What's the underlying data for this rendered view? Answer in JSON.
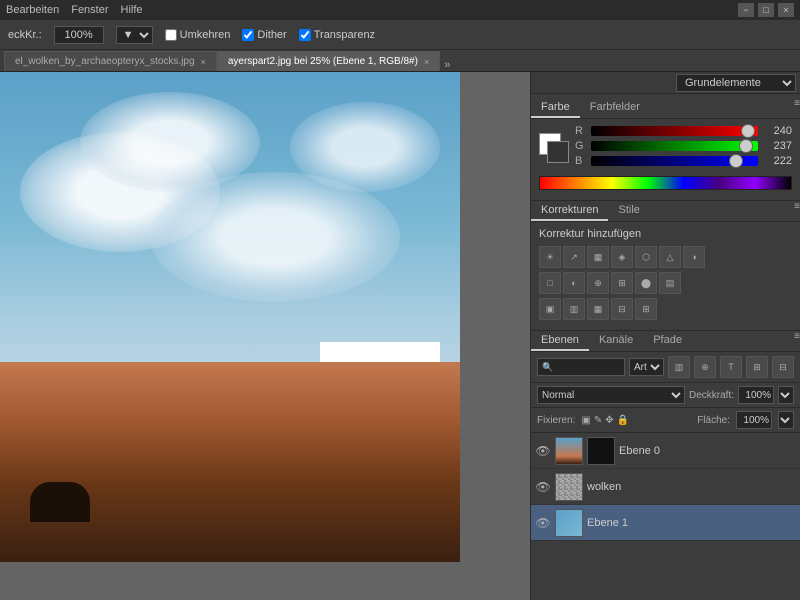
{
  "titlebar": {
    "menus": [
      "Bearbeiten",
      "Fenster",
      "Hilfe"
    ],
    "win_buttons": [
      "−",
      "□",
      "×"
    ]
  },
  "options_bar": {
    "prefix": "eckKr.:",
    "zoom": "100%",
    "umkehren_label": "Umkehren",
    "dither_label": "Dither",
    "transparenz_label": "Transparenz"
  },
  "tabs": [
    {
      "label": "el_wolken_by_archaeopteryx_stocks.jpg",
      "active": false
    },
    {
      "label": "ayerspart2.jpg bei 25% (Ebene 1, RGB/8#)",
      "active": true
    }
  ],
  "right_panel": {
    "grundelemente": "Grundelemente",
    "color_tabs": [
      "Farbe",
      "Farbfelder"
    ],
    "color_values": {
      "r": "240",
      "g": "237",
      "b": "222"
    },
    "korrekturen_tabs": [
      "Korrekturen",
      "Stile"
    ],
    "korrekturen_title": "Korrektur hinzufügen",
    "ebenen_tabs": [
      "Ebenen",
      "Kanäle",
      "Pfade"
    ],
    "search_placeholder": "Art",
    "blend_mode": "Normal",
    "deckkraft_label": "Deckkraft:",
    "deckkraft_value": "100%",
    "fixieren_label": "Fixieren:",
    "flaeche_label": "Fläche:",
    "flaeche_value": "100%",
    "layers": [
      {
        "name": "Ebene 0",
        "visible": true,
        "active": false
      },
      {
        "name": "wolken",
        "visible": true,
        "active": false
      },
      {
        "name": "Ebene 1",
        "visible": true,
        "active": true
      }
    ]
  }
}
